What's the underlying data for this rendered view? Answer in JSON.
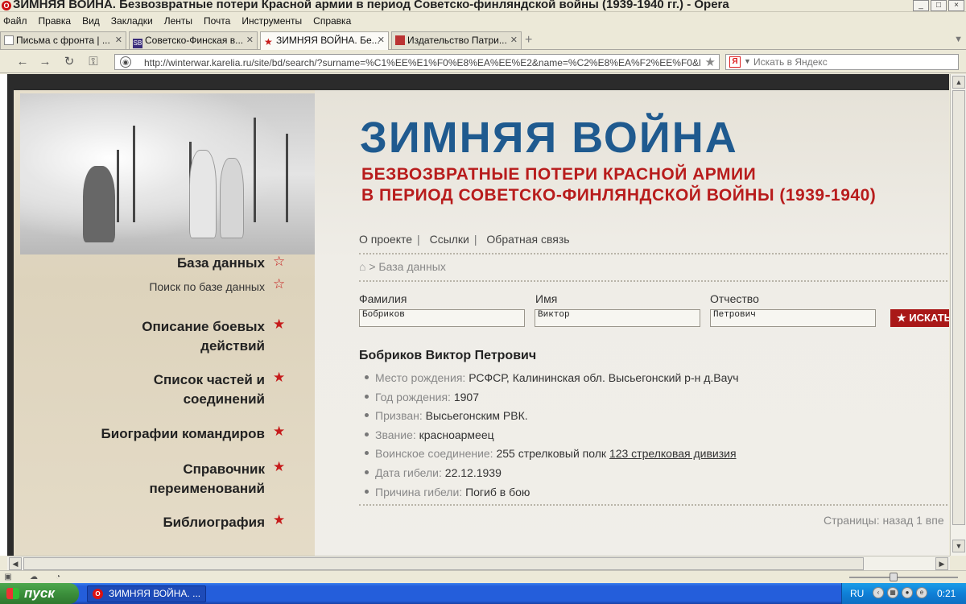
{
  "window": {
    "title": "ЗИМНЯЯ ВОЙНА. Безвозвратные потери Красной армии в период Советско-финляндской войны (1939-1940 гг.) - Opera",
    "controls": [
      "_",
      "□",
      "×"
    ]
  },
  "menu": [
    "Файл",
    "Правка",
    "Вид",
    "Закладки",
    "Ленты",
    "Почта",
    "Инструменты",
    "Справка"
  ],
  "tabs": [
    {
      "label": "Письма с фронта | ...",
      "active": false
    },
    {
      "label": "Советско-Финская в...",
      "active": false
    },
    {
      "label": "ЗИМНЯЯ ВОЙНА. Бе...",
      "active": true
    },
    {
      "label": "Издательство Патри...",
      "active": false
    }
  ],
  "addressbar": {
    "url": "http://winterwar.karelia.ru/site/bd/search/?surname=%C1%EE%E1%F0%E8%EA%EE%E2&name=%C2%E8%EA%F2%EE%F0&l",
    "search_placeholder": "Искать в Яндекс"
  },
  "sidebar": {
    "items": [
      {
        "label": "База данных",
        "star": "outline"
      },
      {
        "label": "Поиск по базе данных",
        "star": "outline",
        "sub": true
      },
      {
        "label": "Описание боевых действий",
        "star": "filled"
      },
      {
        "label": "Список частей и соединений",
        "star": "filled"
      },
      {
        "label": "Биографии командиров",
        "star": "filled"
      },
      {
        "label": "Справочник переименований",
        "star": "filled"
      },
      {
        "label": "Библиография",
        "star": "filled"
      }
    ]
  },
  "header": {
    "title": "ЗИМНЯЯ ВОЙНА",
    "subtitle_line1": "БЕЗВОЗВРАТНЫЕ ПОТЕРИ КРАСНОЙ АРМИИ",
    "subtitle_line2": "В ПЕРИОД СОВЕТСКО-ФИНЛЯНДСКОЙ ВОЙНЫ (1939-1940)"
  },
  "topnav": [
    "О проекте",
    "Ссылки",
    "Обратная связь"
  ],
  "breadcrumb": "> База данных",
  "form": {
    "surname_label": "Фамилия",
    "surname_value": "Бобриков",
    "name_label": "Имя",
    "name_value": "Виктор",
    "patronymic_label": "Отчество",
    "patronymic_value": "Петрович",
    "search_button": "ИСКАТЬ"
  },
  "result": {
    "full_name": "Бобриков Виктор Петрович",
    "birthplace_label": "Место рождения:",
    "birthplace": "РСФСР, Калининская обл. Высьегонский р-н д.Вауч",
    "birthyear_label": "Год рождения:",
    "birthyear": "1907",
    "drafted_label": "Призван:",
    "drafted": "Высьегонским РВК.",
    "rank_label": "Звание:",
    "rank": "красноармеец",
    "unit_label": "Воинское соединение:",
    "unit": "255 стрелковый полк",
    "division_link": "123 стрелковая дивизия",
    "death_date_label": "Дата гибели:",
    "death_date": "22.12.1939",
    "death_cause_label": "Причина гибели:",
    "death_cause": "Погиб в бою"
  },
  "pager": "Страницы: назад 1 впе",
  "taskbar": {
    "start": "пуск",
    "task": "ЗИМНЯЯ ВОЙНА. ...",
    "lang": "RU",
    "clock": "0:21"
  },
  "colors": {
    "title_blue": "#1f5a8f",
    "subtitle_red": "#b81c1c",
    "star_red": "#c61b1b",
    "xp_blue": "#245edb"
  }
}
